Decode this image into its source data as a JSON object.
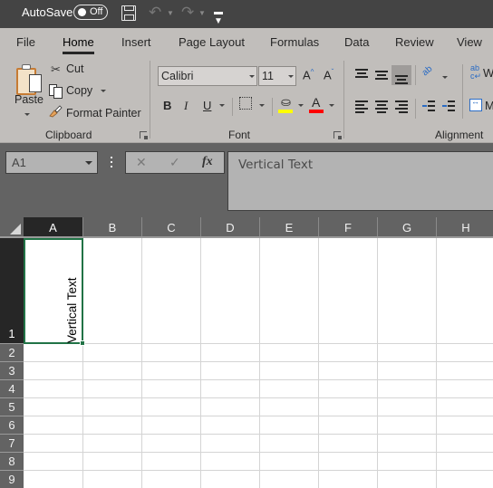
{
  "titlebar": {
    "autosave_label": "AutoSave",
    "autosave_state": "Off",
    "icons": [
      "save-icon",
      "undo-icon",
      "redo-icon",
      "customize-quick-access-icon"
    ]
  },
  "tabs": [
    {
      "label": "File",
      "active": false
    },
    {
      "label": "Home",
      "active": true
    },
    {
      "label": "Insert",
      "active": false
    },
    {
      "label": "Page Layout",
      "active": false
    },
    {
      "label": "Formulas",
      "active": false
    },
    {
      "label": "Data",
      "active": false
    },
    {
      "label": "Review",
      "active": false
    },
    {
      "label": "View",
      "active": false
    }
  ],
  "ribbon": {
    "clipboard": {
      "label": "Clipboard",
      "paste": "Paste",
      "cut": "Cut",
      "copy": "Copy",
      "format_painter": "Format Painter"
    },
    "font": {
      "label": "Font",
      "font_name": "Calibri",
      "font_size": "11",
      "bold": "B",
      "italic": "I",
      "underline": "U",
      "grow": "A",
      "shrink": "A",
      "font_color_glyph": "A",
      "highlight_color": "#ffff00",
      "font_color": "#ff0000"
    },
    "alignment": {
      "label": "Alignment",
      "wrap_text": "W",
      "merge": "M",
      "orientation_glyph": "ab",
      "active_vertical_align": "bottom"
    }
  },
  "formula_bar": {
    "name_box": "A1",
    "cancel": "✕",
    "enter": "✓",
    "fx": "fx",
    "content": "Vertical Text"
  },
  "grid": {
    "columns": [
      "A",
      "B",
      "C",
      "D",
      "E",
      "F",
      "G",
      "H"
    ],
    "rows": [
      "1",
      "2",
      "3",
      "4",
      "5",
      "6",
      "7",
      "8",
      "9"
    ],
    "selected_cell": "A1",
    "cells": {
      "A1": "Vertical Text"
    },
    "accent": "#217346"
  }
}
